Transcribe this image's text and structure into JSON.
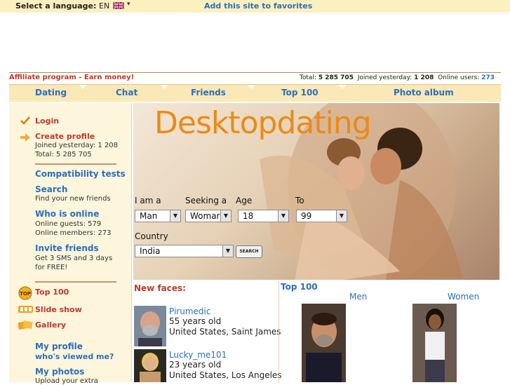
{
  "topbar": {
    "language_label": "Select a language:",
    "language_code": "EN",
    "favorites_link": "Add this site to favorites"
  },
  "stats": {
    "affiliate": "Affiliate program - Earn money!",
    "total_label": "Total:",
    "total_value": "5 285 705",
    "joined_label": "Joined yesterday:",
    "joined_value": "1 208",
    "online_label": "Online users:",
    "online_value": "273"
  },
  "tabs": [
    {
      "label": "Dating"
    },
    {
      "label": "Chat"
    },
    {
      "label": "Friends"
    },
    {
      "label": "Top 100"
    },
    {
      "label": "Photo album"
    }
  ],
  "sidebar": {
    "login": "Login",
    "create_profile": "Create profile",
    "joined_line": "Joined yesterday: 1 208",
    "total_line": "Total: 5 285 705",
    "compat": "Compatibility tests",
    "search": "Search",
    "search_sub": "Find your new friends",
    "who_online": "Who is online",
    "online_guests": "Online guests: 579",
    "online_members": "Online members: 273",
    "invite": "Invite friends",
    "invite_sub1": "Get 3 SMS and 3 days",
    "invite_sub2": "for FREE!",
    "top100": "Top 100",
    "slideshow": "Slide show",
    "gallery": "Gallery",
    "my_profile": "My profile",
    "who_viewed": "who's viewed me?",
    "my_photos": "My photos",
    "upload_extra": "Upload your extra"
  },
  "hero": {
    "logo": "Desktopdating",
    "i_am_label": "I am a",
    "seeking_label": "Seeking a",
    "age_label": "Age",
    "to_label": "To",
    "i_am_value": "Man",
    "seeking_value": "Womar",
    "age_from": "18",
    "age_to": "99",
    "country_label": "Country",
    "country_value": "India",
    "search_button": "SEARCH"
  },
  "new_faces": {
    "title": "New faces:",
    "items": [
      {
        "name": "Pirumedic",
        "age": "55 years old",
        "location": "United States, Saint James"
      },
      {
        "name": "Lucky_me101",
        "age": "23 years old",
        "location": "United States, Los Angeles"
      }
    ]
  },
  "top100": {
    "title": "Top 100",
    "men_label": "Men",
    "women_label": "Women"
  },
  "colors": {
    "accent_blue": "#2a6fc1",
    "accent_red": "#c0392b",
    "logo_orange": "#ec8a16",
    "tab_bg": "#fae8b6"
  }
}
